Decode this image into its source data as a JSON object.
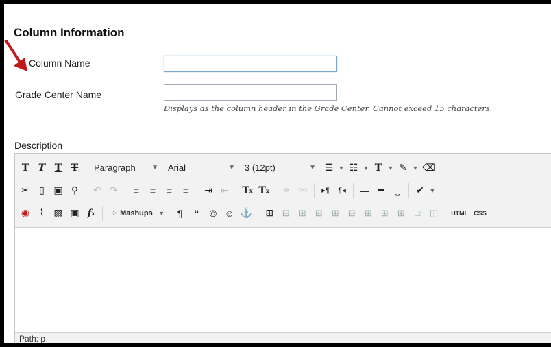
{
  "section": {
    "title": "Column Information"
  },
  "fields": {
    "column_name_label": "Column Name",
    "column_name_value": "",
    "grade_center_name_label": "Grade Center Name",
    "grade_center_name_value": "",
    "grade_center_hint": "Displays as the column header in the Grade Center. Cannot exceed 15 characters.",
    "description_label": "Description"
  },
  "editor": {
    "format_select": "Paragraph",
    "font_select": "Arial",
    "size_select": "3 (12pt)",
    "mashups_label": "Mashups",
    "html_label": "HTML",
    "css_label": "CSS",
    "path_label": "Path: p"
  },
  "colors": {
    "arrow": "#c0191b",
    "accent_border": "#7ea4c9"
  }
}
